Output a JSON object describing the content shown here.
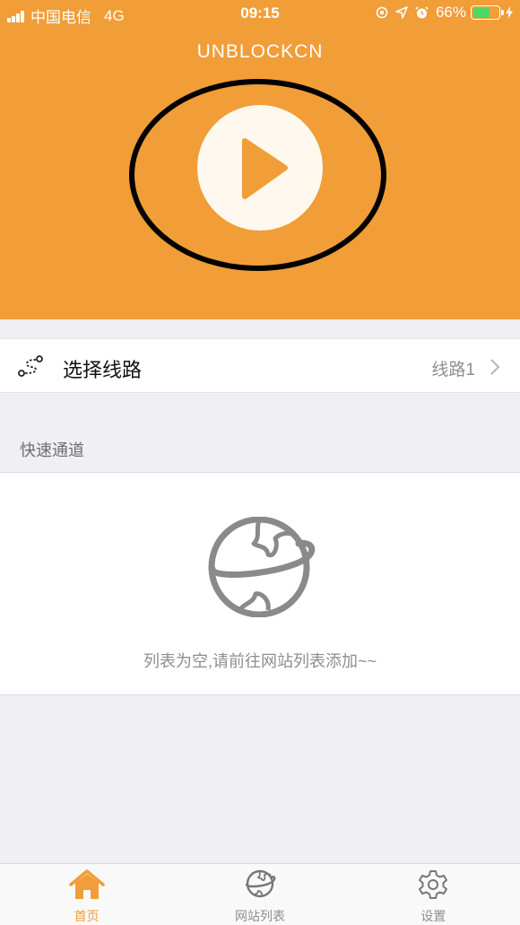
{
  "status_bar": {
    "carrier": "中国电信",
    "network": "4G",
    "time": "09:15",
    "battery_percent": "66%",
    "battery_level": 0.66
  },
  "header": {
    "app_title": "UNBLOCKCN",
    "background_color": "#f19d38"
  },
  "route": {
    "icon": "route-icon",
    "label": "选择线路",
    "value": "线路1"
  },
  "quick_channel": {
    "section_title": "快速通道",
    "empty_icon": "globe-icon",
    "empty_text": "列表为空,请前往网站列表添加~~"
  },
  "tabs": [
    {
      "label": "首页",
      "icon": "home-icon",
      "active": true
    },
    {
      "label": "网站列表",
      "icon": "globe-icon",
      "active": false
    },
    {
      "label": "设置",
      "icon": "gear-icon",
      "active": false
    }
  ],
  "colors": {
    "accent": "#f19d38",
    "background": "#efeff4",
    "secondary_text": "#8e8e93"
  }
}
